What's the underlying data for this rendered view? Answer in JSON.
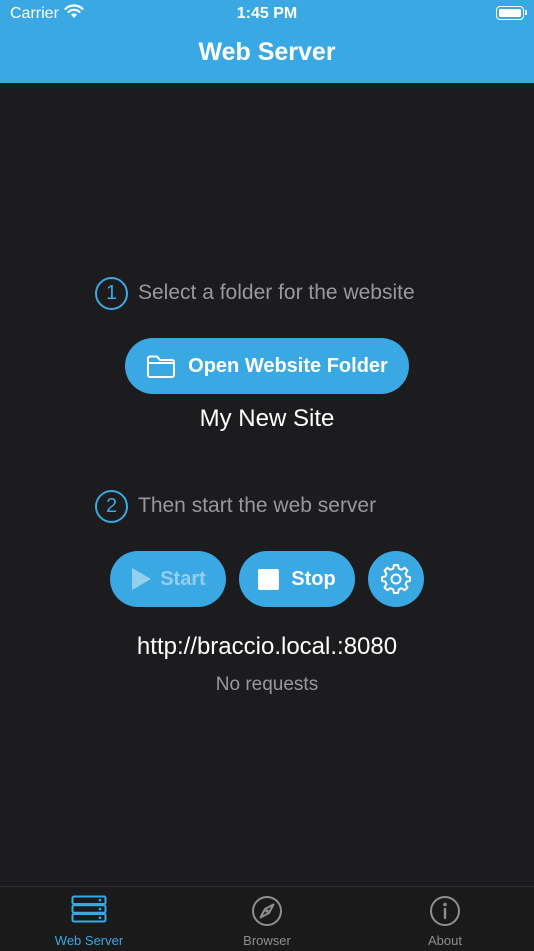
{
  "status_bar": {
    "carrier": "Carrier",
    "time": "1:45 PM"
  },
  "nav": {
    "title": "Web Server"
  },
  "step1": {
    "number": "1",
    "text": "Select a folder for the website"
  },
  "open_button": {
    "label": "Open Website Folder",
    "icon": "folder-icon"
  },
  "site_name": "My New Site",
  "step2": {
    "number": "2",
    "text": "Then start the web server"
  },
  "controls": {
    "start_label": "Start",
    "stop_label": "Stop",
    "settings_icon": "gear-icon"
  },
  "server": {
    "url": "http://braccio.local.:8080",
    "requests": "No requests"
  },
  "tabs": [
    {
      "label": "Web Server",
      "icon": "server-icon",
      "active": true
    },
    {
      "label": "Browser",
      "icon": "compass-icon",
      "active": false
    },
    {
      "label": "About",
      "icon": "info-icon",
      "active": false
    }
  ],
  "colors": {
    "accent": "#3aa8e2",
    "background": "#1c1c1e",
    "muted": "#98989d"
  }
}
